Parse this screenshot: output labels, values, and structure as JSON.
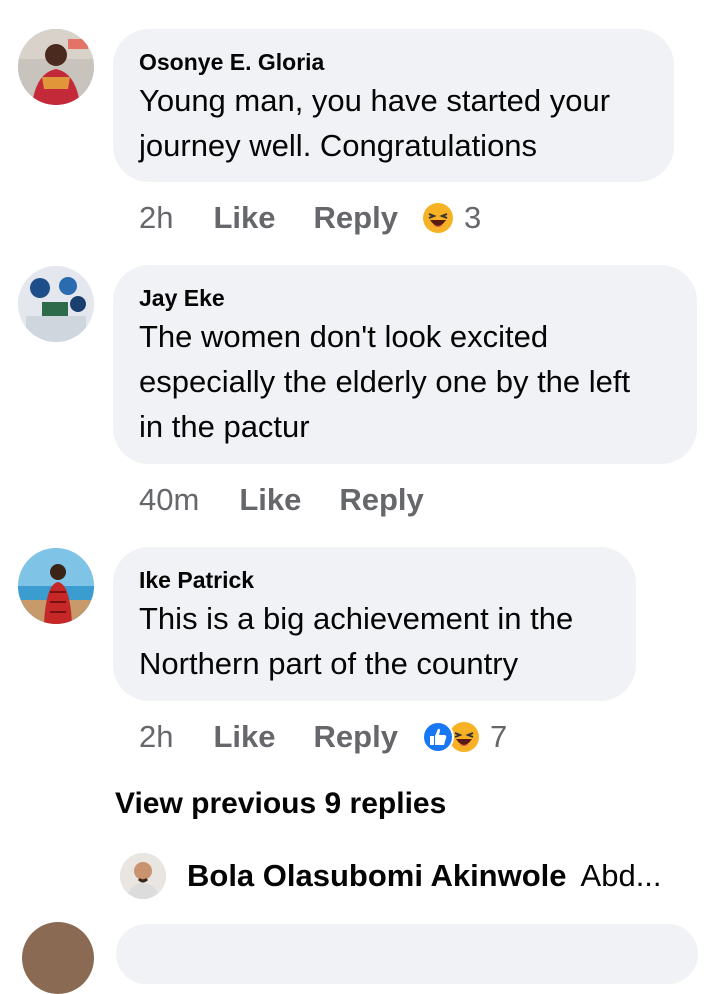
{
  "comments": [
    {
      "author": "Osonye E. Gloria",
      "lines": [
        "Young man, you have started your",
        "journey well. Congratulations"
      ],
      "time": "2h",
      "like": "Like",
      "reply": "Reply",
      "reactions": [
        "haha-icon"
      ],
      "reaction_count": "3"
    },
    {
      "author": "Jay Eke",
      "lines": [
        "The women don't look excited",
        "especially the elderly one by the left",
        "in the pactur"
      ],
      "time": "40m",
      "like": "Like",
      "reply": "Reply"
    },
    {
      "author": "Ike Patrick",
      "lines": [
        "This is a big achievement in the",
        "Northern part of the country"
      ],
      "time": "2h",
      "like": "Like",
      "reply": "Reply",
      "reactions": [
        "like-icon",
        "haha-icon"
      ],
      "reaction_count": "7"
    }
  ],
  "view_previous": "View previous 9 replies",
  "reply_preview": {
    "author": "Bola Olasubomi Akinwole",
    "text": "Abd..."
  },
  "colors": {
    "bubble": "#f0f2f5",
    "meta_text": "#65676b",
    "like_blue": "#1877f2",
    "haha_yellow": "#f7b125"
  }
}
